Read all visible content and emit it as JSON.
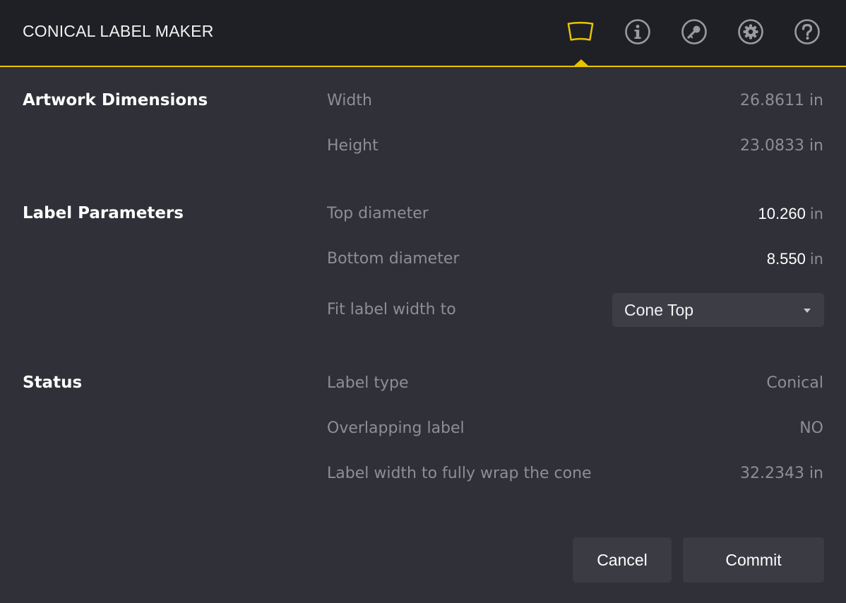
{
  "header": {
    "title": "CONICAL LABEL MAKER",
    "icons": [
      "cone-label-icon",
      "info-icon",
      "key-icon",
      "gear-icon",
      "help-icon"
    ],
    "accent_color": "#e8c400"
  },
  "sections": {
    "artwork": {
      "title": "Artwork Dimensions",
      "width_label": "Width",
      "width_value": "26.8611 in",
      "height_label": "Height",
      "height_value": "23.0833 in"
    },
    "parameters": {
      "title": "Label Parameters",
      "top_label": "Top diameter",
      "top_value": "10.260",
      "top_unit": "in",
      "bottom_label": "Bottom diameter",
      "bottom_value": "8.550",
      "bottom_unit": "in",
      "fit_label": "Fit label width to",
      "fit_selected": "Cone Top"
    },
    "status": {
      "title": "Status",
      "type_label": "Label type",
      "type_value": "Conical",
      "overlap_label": "Overlapping label",
      "overlap_value": "NO",
      "wrap_label": "Label width to fully wrap the cone",
      "wrap_value": "32.2343 in"
    }
  },
  "actions": {
    "cancel_label": "Cancel",
    "commit_label": "Commit"
  }
}
